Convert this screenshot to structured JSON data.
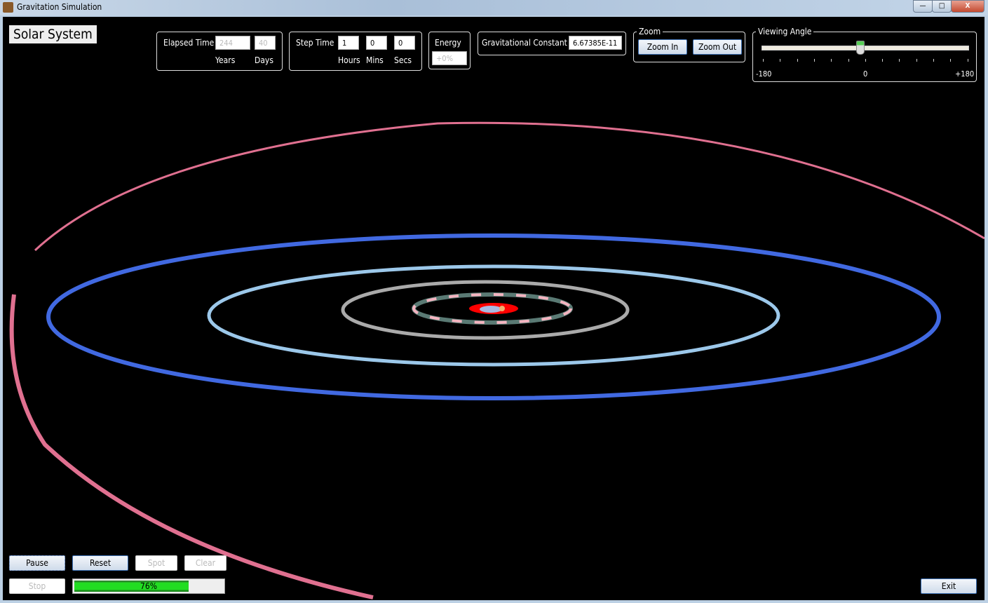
{
  "window": {
    "title": "Gravitation Simulation",
    "min": "—",
    "max": "□",
    "close": "X"
  },
  "header": {
    "system_name": "Solar System"
  },
  "elapsed": {
    "label": "Elapsed Time",
    "years": "244",
    "days": "40",
    "years_label": "Years",
    "days_label": "Days"
  },
  "step": {
    "label": "Step Time",
    "hours": "1",
    "mins": "0",
    "secs": "0",
    "hours_label": "Hours",
    "mins_label": "Mins",
    "secs_label": "Secs"
  },
  "energy": {
    "label": "Energy",
    "value": "+0%"
  },
  "gravity": {
    "label": "Gravitational Constant",
    "value": "6.67385E-11"
  },
  "zoom": {
    "label": "Zoom",
    "in": "Zoom In",
    "out": "Zoom Out"
  },
  "angle": {
    "label": "Viewing Angle",
    "min": "-180",
    "mid": "0",
    "max": "+180",
    "value": -8
  },
  "controls": {
    "pause": "Pause",
    "reset": "Reset",
    "spot": "Spot",
    "clear": "Clear",
    "stop": "Stop",
    "exit": "Exit",
    "progress": 76,
    "progress_text": "76%"
  },
  "colors": {
    "outer_orbit": "#e07090",
    "blue_orbit": "#4169e1",
    "lightblue_orbit": "#9cc8ea",
    "gray_orbit": "#aaaaaa",
    "asteroids": "#5a7a74",
    "asteroid_pink": "#f4b4c0",
    "inner": "#ff0000"
  }
}
